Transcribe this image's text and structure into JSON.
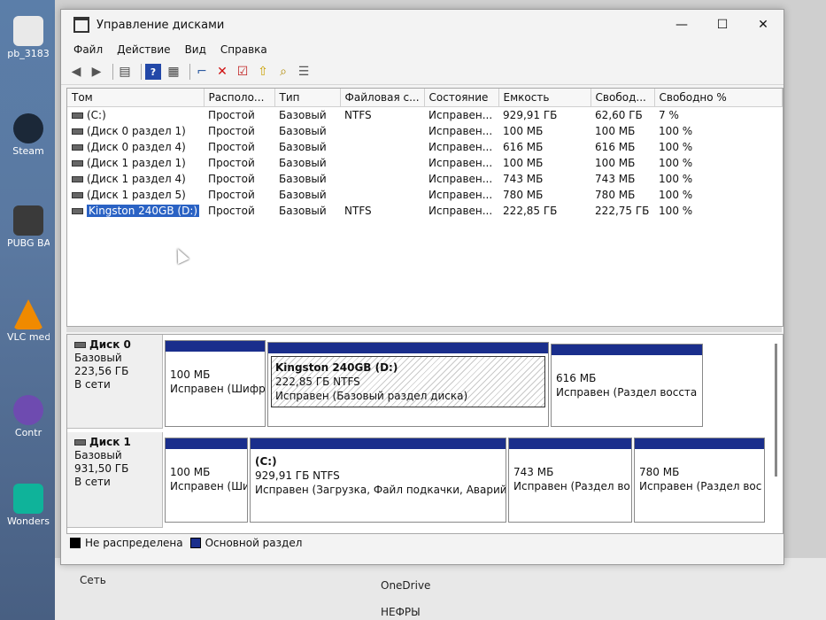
{
  "desktop": {
    "icons": [
      {
        "label": "pb_3183",
        "icon": "file-icon",
        "color": "#e9e9e9"
      },
      {
        "label": "Steam",
        "icon": "steam-icon",
        "color": "#1b2838"
      },
      {
        "label": "PUBG BATTLEGR",
        "icon": "pubg-icon",
        "color": "#3a3a3a"
      },
      {
        "label": "VLC media player",
        "icon": "vlc-icon",
        "color": "#f08a00"
      },
      {
        "label": "Contr",
        "icon": "app-icon",
        "color": "#6e4bb0"
      },
      {
        "label": "Wondershare Filmora",
        "icon": "filmora-icon",
        "color": "#0fb39a"
      }
    ],
    "behind_items": [
      "Сеть",
      "OneDrive",
      "НЕФРЫ"
    ]
  },
  "window": {
    "title": "Управление дисками",
    "controls": {
      "minimize": "—",
      "maximize": "☐",
      "close": "✕"
    }
  },
  "menu": [
    "Файл",
    "Действие",
    "Вид",
    "Справка"
  ],
  "toolbar": [
    "back-icon",
    "forward-icon",
    "properties-icon",
    "help-icon",
    "console-icon",
    "connect-icon",
    "delete-icon",
    "checklist-icon",
    "import-icon",
    "search-icon",
    "list-icon"
  ],
  "volumes": {
    "columns": [
      "Том",
      "Располо...",
      "Тип",
      "Файловая с...",
      "Состояние",
      "Емкость",
      "Свобод...",
      "Свободно %"
    ],
    "rows": [
      [
        "(C:)",
        "Простой",
        "Базовый",
        "NTFS",
        "Исправен...",
        "929,91 ГБ",
        "62,60 ГБ",
        "7 %"
      ],
      [
        "(Диск 0 раздел 1)",
        "Простой",
        "Базовый",
        "",
        "Исправен...",
        "100 МБ",
        "100 МБ",
        "100 %"
      ],
      [
        "(Диск 0 раздел 4)",
        "Простой",
        "Базовый",
        "",
        "Исправен...",
        "616 МБ",
        "616 МБ",
        "100 %"
      ],
      [
        "(Диск 1 раздел 1)",
        "Простой",
        "Базовый",
        "",
        "Исправен...",
        "100 МБ",
        "100 МБ",
        "100 %"
      ],
      [
        "(Диск 1 раздел 4)",
        "Простой",
        "Базовый",
        "",
        "Исправен...",
        "743 МБ",
        "743 МБ",
        "100 %"
      ],
      [
        "(Диск 1 раздел 5)",
        "Простой",
        "Базовый",
        "",
        "Исправен...",
        "780 МБ",
        "780 МБ",
        "100 %"
      ],
      [
        "Kingston 240GB (D:)",
        "Простой",
        "Базовый",
        "NTFS",
        "Исправен...",
        "222,85 ГБ",
        "222,75 ГБ",
        "100 %"
      ]
    ],
    "selected_row": 6
  },
  "disks": [
    {
      "name": "Диск 0",
      "type": "Базовый",
      "size": "223,56 ГБ",
      "status": "В сети",
      "partitions": [
        {
          "title": "",
          "line1": "100 МБ",
          "line2": "Исправен (Шифр"
        },
        {
          "title": "Kingston 240GB  (D:)",
          "line1": "222,85 ГБ NTFS",
          "line2": "Исправен (Базовый раздел диска)",
          "selected": true
        },
        {
          "title": "",
          "line1": "616 МБ",
          "line2": "Исправен (Раздел восста"
        }
      ]
    },
    {
      "name": "Диск 1",
      "type": "Базовый",
      "size": "931,50 ГБ",
      "status": "В сети",
      "partitions": [
        {
          "title": "",
          "line1": "100 МБ",
          "line2": "Исправен (Ши"
        },
        {
          "title": "(C:)",
          "line1": "929,91 ГБ NTFS",
          "line2": "Исправен (Загрузка, Файл подкачки, Аварийн"
        },
        {
          "title": "",
          "line1": "743 МБ",
          "line2": "Исправен (Раздел во"
        },
        {
          "title": "",
          "line1": "780 МБ",
          "line2": "Исправен (Раздел вос"
        }
      ]
    }
  ],
  "legend": [
    {
      "label": "Не распределена",
      "color": "#000000"
    },
    {
      "label": "Основной раздел",
      "color": "#1a2e8c"
    }
  ]
}
